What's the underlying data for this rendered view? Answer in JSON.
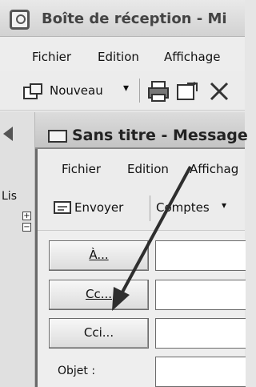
{
  "outer_window": {
    "title": "Boîte de réception - Mi",
    "menu": {
      "fichier": "Fichier",
      "edition": "Edition",
      "affichage": "Affichage"
    },
    "toolbar": {
      "new_label": "Nouveau",
      "new_dropdown": "▾"
    },
    "left_panel_label": "Lis",
    "tree": {
      "expand": "+",
      "collapse": "−"
    }
  },
  "compose_window": {
    "title": "Sans titre - Message",
    "menu": {
      "fichier": "Fichier",
      "edition": "Edition",
      "affichage": "Affichag"
    },
    "toolbar": {
      "send_label": "Envoyer",
      "accounts_label": "Comptes",
      "accounts_dropdown": "▾"
    },
    "fields": {
      "to_button": "À...",
      "cc_button": "Cc...",
      "bcc_button": "Cci...",
      "subject_label": "Objet :"
    }
  }
}
